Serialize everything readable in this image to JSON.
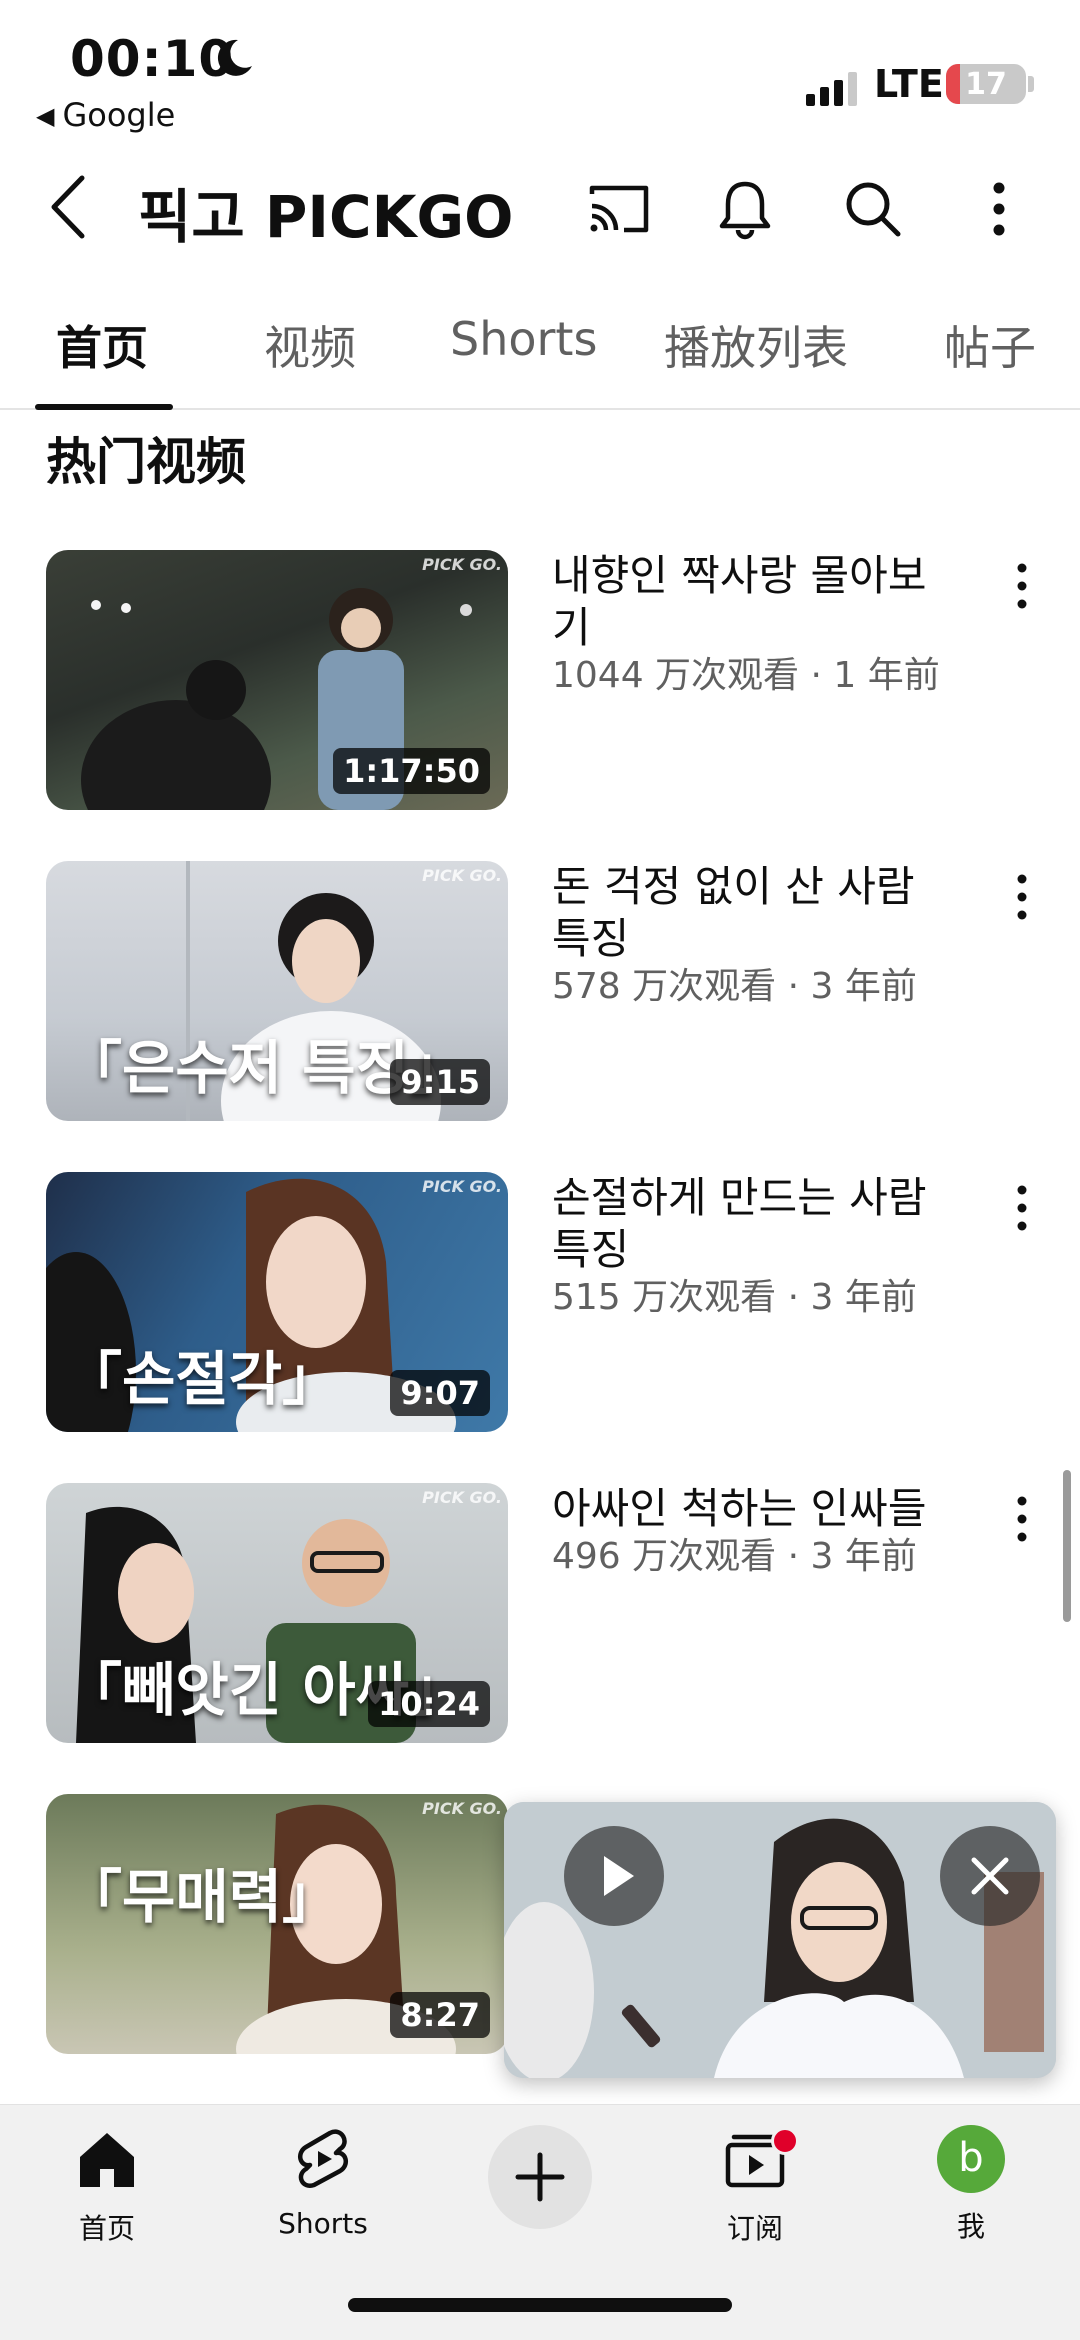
{
  "status_bar": {
    "time": "00:10",
    "back_app": "Google",
    "network": "LTE",
    "battery": "17"
  },
  "header": {
    "title": "픽고 PICKGO"
  },
  "tabs": [
    {
      "label": "首页"
    },
    {
      "label": "视频"
    },
    {
      "label": "Shorts"
    },
    {
      "label": "播放列表"
    },
    {
      "label": "帖子"
    }
  ],
  "section": {
    "title": "热门视频"
  },
  "videos": [
    {
      "title": "내향인 짝사랑 몰아보기",
      "meta": "1044 万次观看 · 1 年前",
      "duration": "1:17:50",
      "overlay": ""
    },
    {
      "title": "돈 걱정 없이 산 사람 특징",
      "meta": "578 万次观看 · 3 年前",
      "duration": "9:15",
      "overlay": "「은수저 특징」"
    },
    {
      "title": "손절하게 만드는 사람 특징",
      "meta": "515 万次观看 · 3 年前",
      "duration": "9:07",
      "overlay": "「손절각」"
    },
    {
      "title": "아싸인 척하는 인싸들",
      "meta": "496 万次观看 · 3 年前",
      "duration": "10:24",
      "overlay": "「빼앗긴 아싸」"
    },
    {
      "title": "",
      "meta": "",
      "duration": "8:27",
      "overlay": "「무매력」"
    }
  ],
  "watermark": "PICK GO.",
  "bottom_nav": {
    "home": "首页",
    "shorts": "Shorts",
    "subscriptions": "订阅",
    "me": "我",
    "avatar_letter": "b"
  },
  "colors": {
    "accent_red": "#e0002a",
    "battery_red": "#e5484d",
    "avatar_green": "#56a93a"
  }
}
